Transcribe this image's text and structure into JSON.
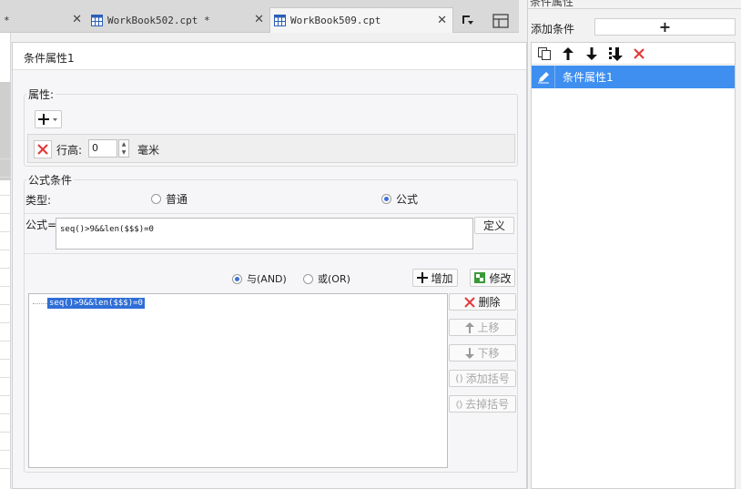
{
  "tabs": [
    {
      "label": "*",
      "close": "✕"
    },
    {
      "label": "WorkBook502.cpt *",
      "close": "✕"
    },
    {
      "label": "WorkBook509.cpt",
      "close": "✕",
      "active": true
    }
  ],
  "dialog": {
    "title": "条件属性1",
    "attributes": {
      "legend": "属性:",
      "row_height_label": "行高:",
      "row_height_value": "0",
      "unit_label": "毫米"
    },
    "formula_condition": {
      "legend": "公式条件",
      "type_label": "类型:",
      "type_options": [
        {
          "label": "普通",
          "selected": false
        },
        {
          "label": "公式",
          "selected": true
        }
      ],
      "formula_label": "公式=",
      "formula_value": "seq()>9&&len($$$)=0",
      "define_button": "定义",
      "logic_options": [
        {
          "label": "与(AND)",
          "selected": true
        },
        {
          "label": "或(OR)",
          "selected": false
        }
      ],
      "add_button": "增加",
      "modify_button": "修改",
      "conditions": [
        "seq()>9&&len($$$)=0"
      ],
      "side_buttons": {
        "delete": "删除",
        "move_up": "上移",
        "move_down": "下移",
        "add_bracket": "添加括号",
        "remove_bracket": "去掉括号"
      }
    }
  },
  "right_panel": {
    "top_label": "条件属性",
    "add_condition_label": "添加条件",
    "add_condition_button": "+",
    "items": [
      "条件属性1"
    ]
  },
  "colors": {
    "accent_blue": "#3e8ff0",
    "selection_blue": "#2f6ed6",
    "delete_red": "#e23b3b",
    "modify_green": "#3a9a3a"
  }
}
